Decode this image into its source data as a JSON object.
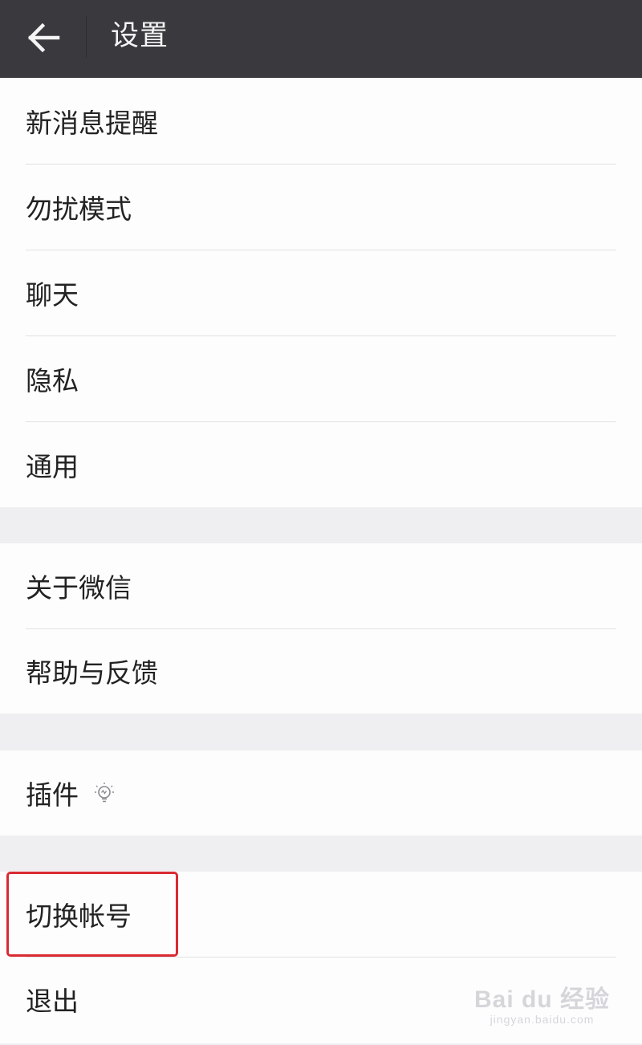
{
  "header": {
    "title": "设置",
    "back_icon": "arrow-left-icon"
  },
  "groups": [
    {
      "items": [
        {
          "label": "新消息提醒"
        },
        {
          "label": "勿扰模式"
        },
        {
          "label": "聊天"
        },
        {
          "label": "隐私"
        },
        {
          "label": "通用"
        }
      ]
    },
    {
      "items": [
        {
          "label": "关于微信"
        },
        {
          "label": "帮助与反馈"
        }
      ]
    },
    {
      "items": [
        {
          "label": "插件",
          "icon": "lightbulb-icon"
        }
      ]
    },
    {
      "items": [
        {
          "label": "切换帐号",
          "highlighted": true
        },
        {
          "label": "退出"
        }
      ]
    }
  ],
  "watermark": {
    "brand": "Bai du 经验",
    "url": "jingyan.baidu.com"
  },
  "colors": {
    "header_bg": "#3a393e",
    "page_bg": "#efeef0",
    "item_bg": "#fefdfe",
    "highlight": "#d92b32"
  }
}
